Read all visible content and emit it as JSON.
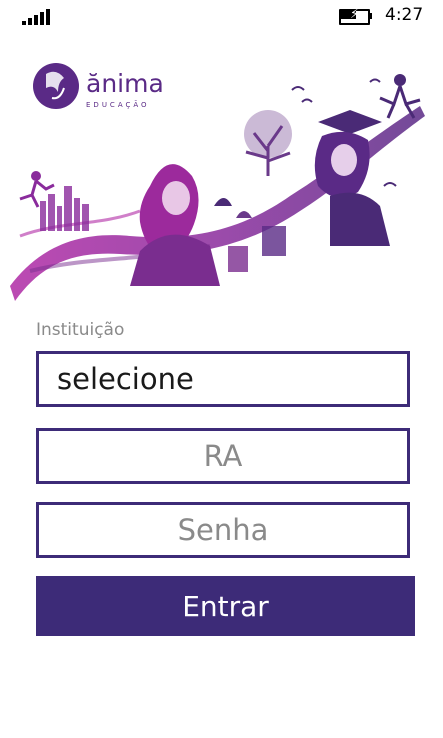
{
  "status_bar": {
    "time": "4:27",
    "signal_icon": "signal-bars-icon",
    "battery_icon": "battery-charging-icon"
  },
  "brand": {
    "name": "ănima",
    "tagline": "EDUCAÇÃO"
  },
  "form": {
    "institution_label": "Instituição",
    "institution_value": "selecione",
    "ra_placeholder": "RA",
    "senha_placeholder": "Senha",
    "submit_label": "Entrar"
  },
  "colors": {
    "accent": "#3d2b78",
    "hero_purple": "#7a2d8f",
    "hero_magenta": "#b02aa5"
  }
}
